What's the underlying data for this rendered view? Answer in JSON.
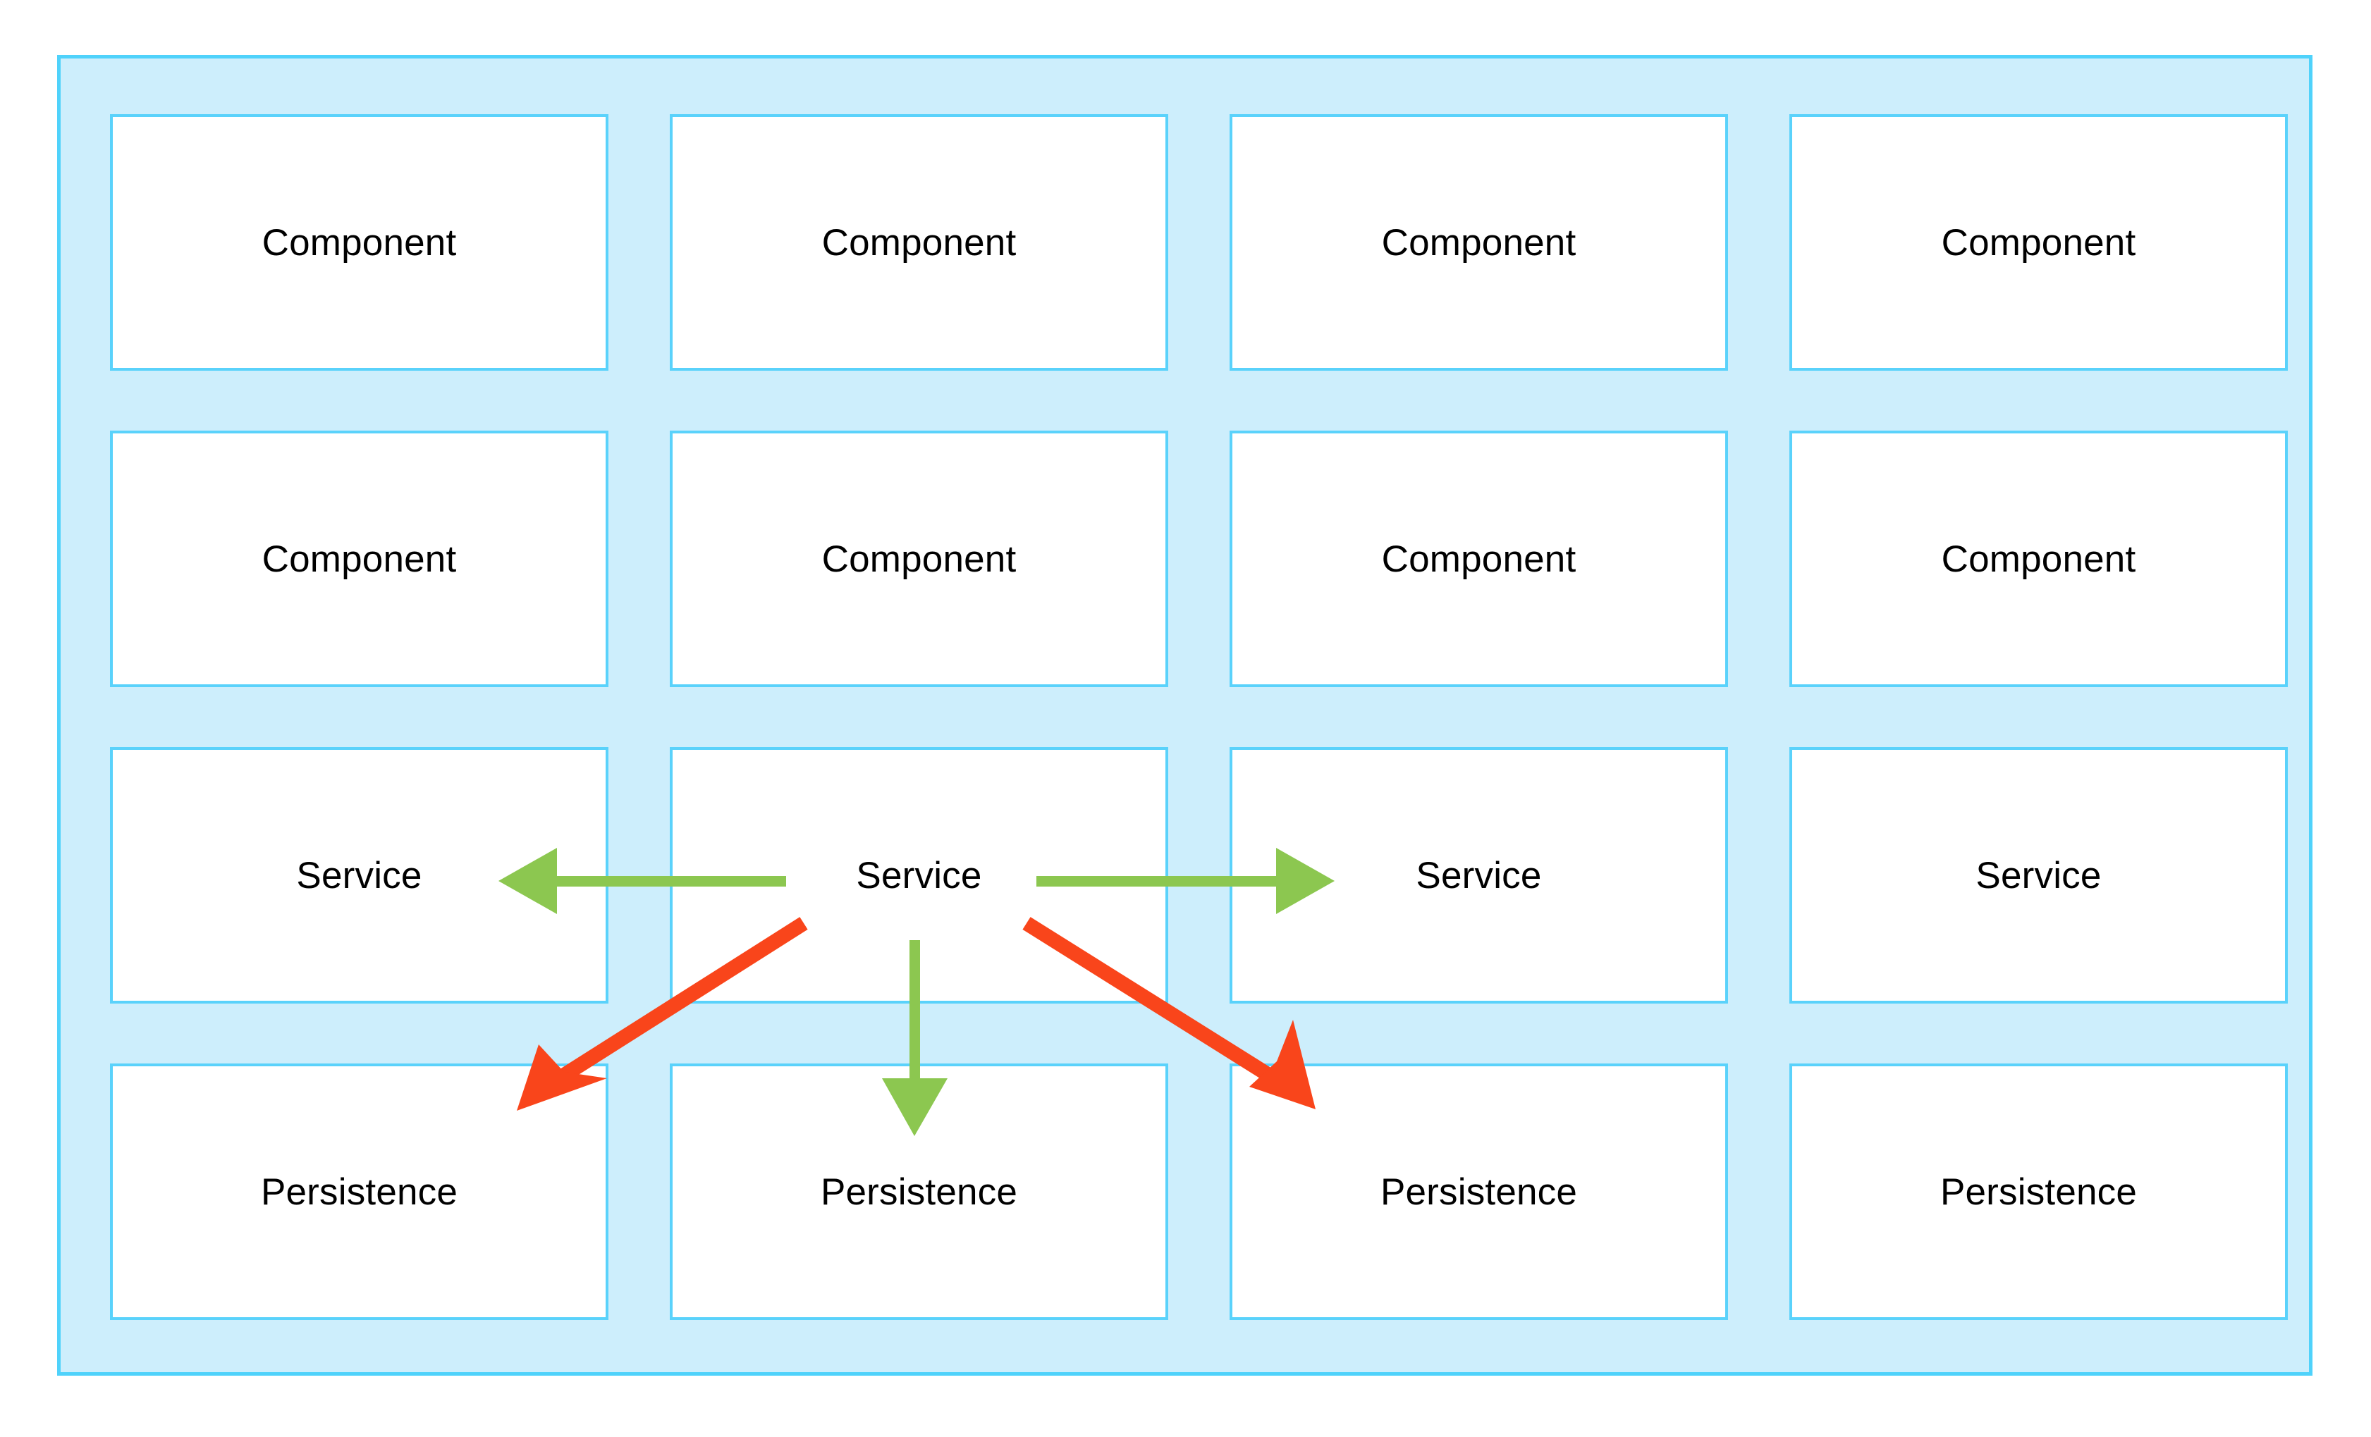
{
  "diagram": {
    "title": "Layered component architecture grid",
    "container": {
      "name": "system-boundary",
      "fill_color": "#cdeefc",
      "border_color": "#4fd2fb"
    },
    "card_style": {
      "fill_color": "#ffffff",
      "border_color": "#5ad2fb",
      "text_color": "#000000"
    },
    "rows": [
      {
        "layer": "component-row-1",
        "cells": [
          {
            "label": "Component"
          },
          {
            "label": "Component"
          },
          {
            "label": "Component"
          },
          {
            "label": "Component"
          }
        ]
      },
      {
        "layer": "component-row-2",
        "cells": [
          {
            "label": "Component"
          },
          {
            "label": "Component"
          },
          {
            "label": "Component"
          },
          {
            "label": "Component"
          }
        ]
      },
      {
        "layer": "service-row",
        "cells": [
          {
            "label": "Service"
          },
          {
            "label": "Service"
          },
          {
            "label": "Service"
          },
          {
            "label": "Service"
          }
        ]
      },
      {
        "layer": "persistence-row",
        "cells": [
          {
            "label": "Persistence"
          },
          {
            "label": "Persistence"
          },
          {
            "label": "Persistence"
          },
          {
            "label": "Persistence"
          }
        ]
      }
    ],
    "connectors": {
      "green_color": "#8cc750",
      "red_color": "#f9451b",
      "items": [
        {
          "name": "service2-to-service1",
          "color_role": "green",
          "direction": "left",
          "from": "Service (col 2)",
          "to": "Service (col 1)"
        },
        {
          "name": "service2-to-service3",
          "color_role": "green",
          "direction": "right",
          "from": "Service (col 2)",
          "to": "Service (col 3)"
        },
        {
          "name": "service2-to-persistence2",
          "color_role": "green",
          "direction": "down",
          "from": "Service (col 2)",
          "to": "Persistence (col 2)"
        },
        {
          "name": "service2-to-persistence1",
          "color_role": "red",
          "direction": "down-left",
          "from": "Service (col 2)",
          "to": "Persistence (col 1)"
        },
        {
          "name": "service2-to-persistence3",
          "color_role": "red",
          "direction": "down-right",
          "from": "Service (col 2)",
          "to": "Persistence (col 3)"
        }
      ]
    }
  }
}
